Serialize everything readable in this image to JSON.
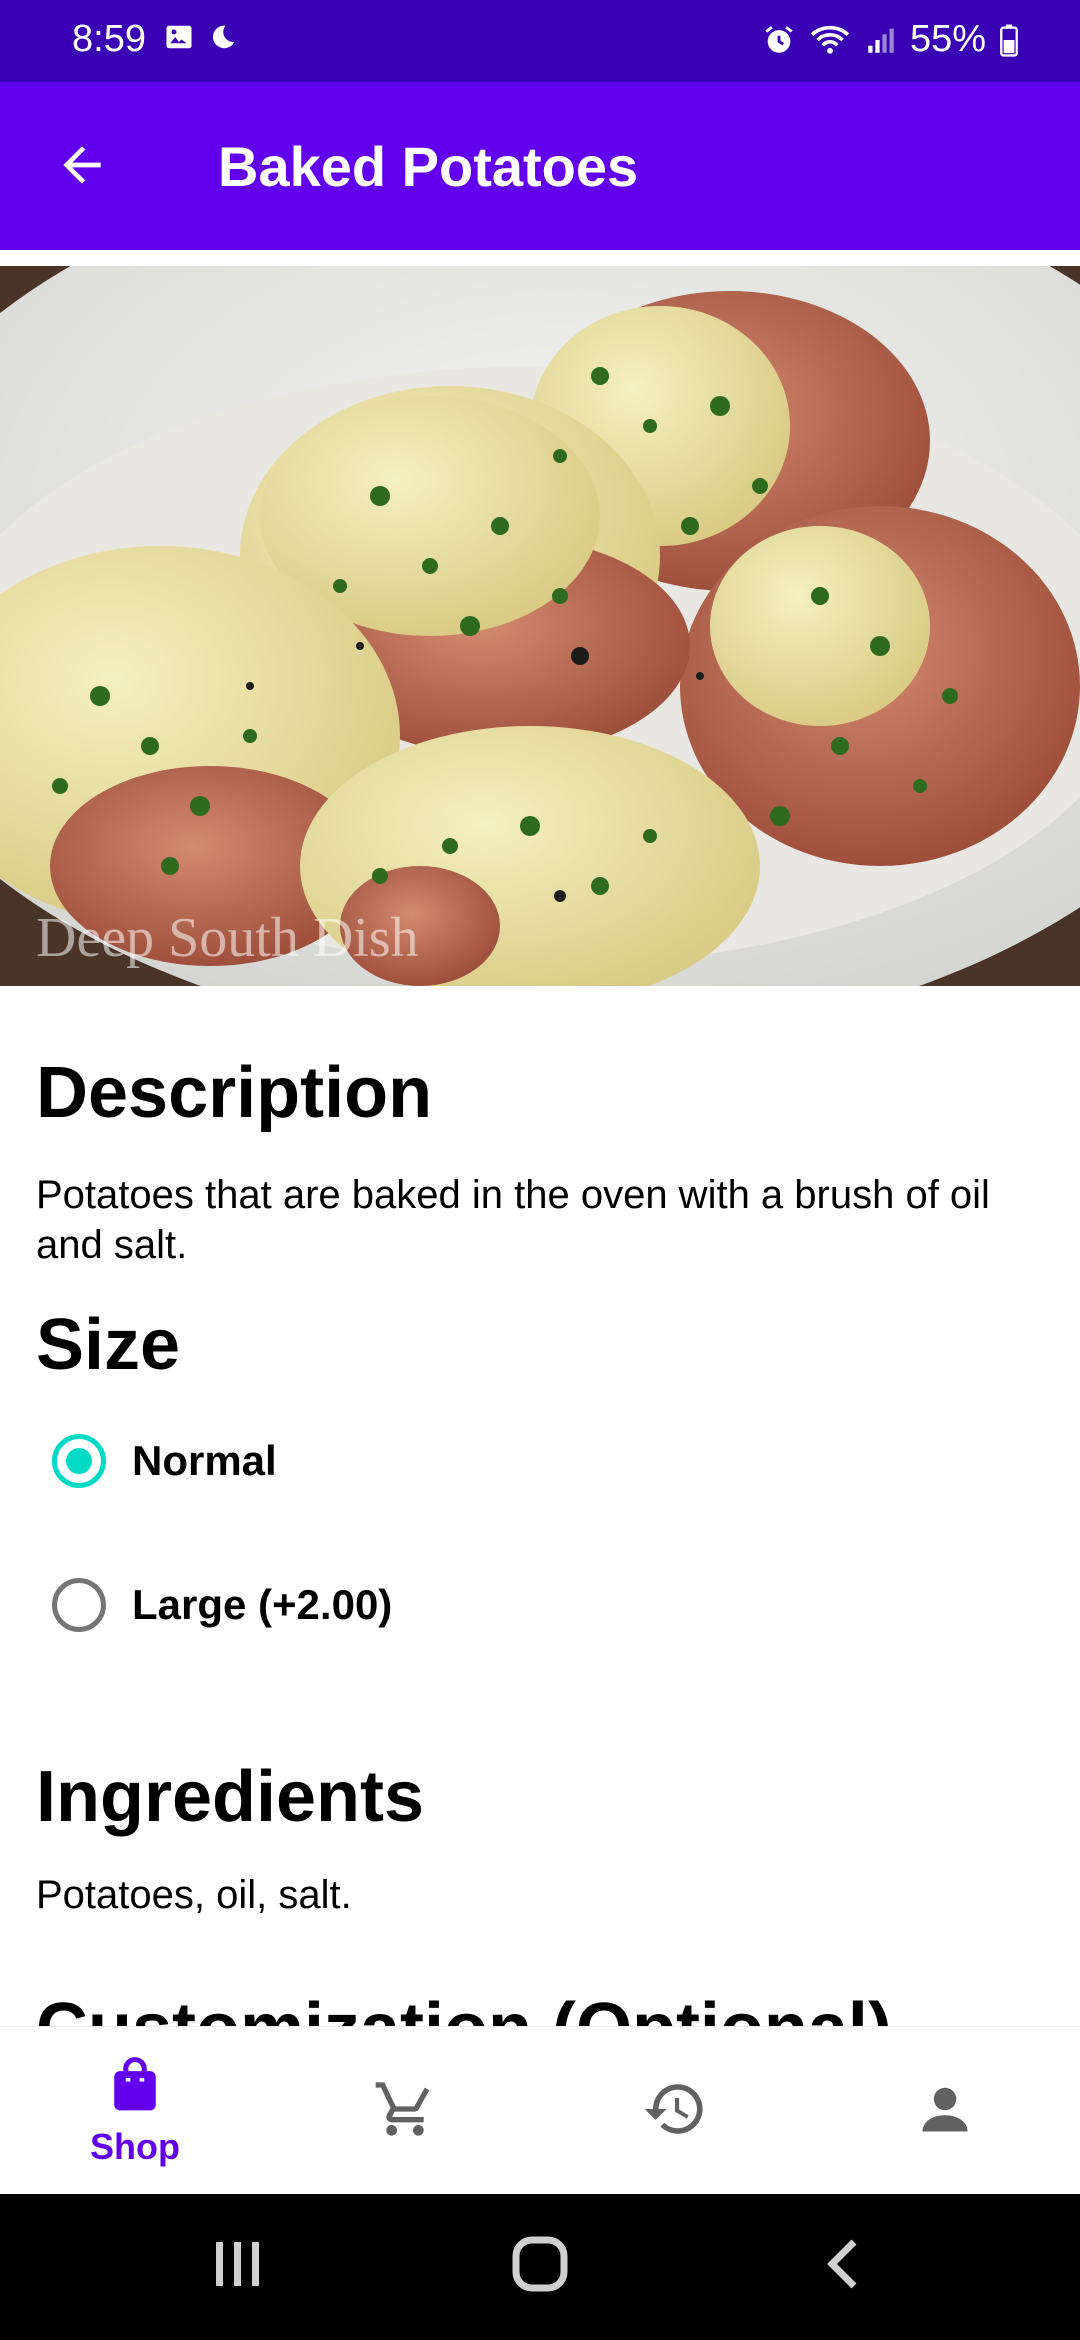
{
  "status_bar": {
    "time": "8:59",
    "battery": "55%",
    "icons": [
      "image-icon",
      "moon-icon",
      "alarm-icon",
      "wifi-icon",
      "signal-icon",
      "battery-icon"
    ]
  },
  "app_bar": {
    "title": "Baked Potatoes",
    "back_icon": "arrow-back-icon"
  },
  "hero": {
    "watermark": "Deep South Dish"
  },
  "description": {
    "heading": "Description",
    "text": "Potatoes that are baked in the oven with a brush of oil and salt."
  },
  "size": {
    "heading": "Size",
    "options": [
      {
        "label": "Normal",
        "selected": true
      },
      {
        "label": "Large (+2.00)",
        "selected": false
      }
    ]
  },
  "ingredients": {
    "heading": "Ingredients",
    "text": "Potatoes, oil, salt."
  },
  "customization": {
    "heading": "Customization (Optional)"
  },
  "bottom_nav": {
    "items": [
      {
        "label": "Shop",
        "icon": "shopping-bag-icon",
        "active": true
      },
      {
        "label": "",
        "icon": "cart-icon",
        "active": false
      },
      {
        "label": "",
        "icon": "history-icon",
        "active": false
      },
      {
        "label": "",
        "icon": "person-icon",
        "active": false
      }
    ],
    "active_color": "#6200ee",
    "inactive_color": "#616161"
  },
  "colors": {
    "status_bar": "#3a00b4",
    "app_bar": "#6200ee",
    "radio_accent": "#03dac5"
  }
}
